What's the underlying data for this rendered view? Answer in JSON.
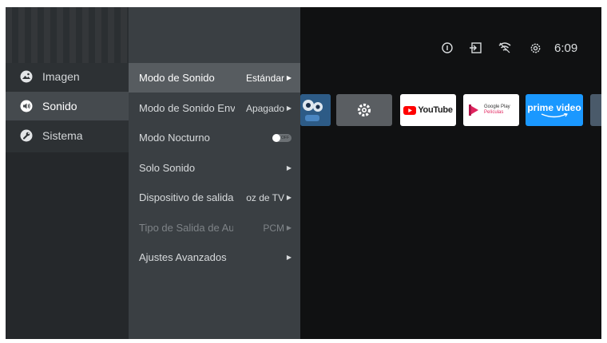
{
  "status_bar": {
    "time": "6:09",
    "icons": [
      "info-icon",
      "input-source-icon",
      "wifi-icon",
      "settings-gear-icon"
    ]
  },
  "categories": [
    {
      "label": "Imagen",
      "icon": "image-icon"
    },
    {
      "label": "Sonido",
      "icon": "speaker-icon",
      "selected": true
    },
    {
      "label": "Sistema",
      "icon": "wrench-icon"
    }
  ],
  "submenu": [
    {
      "label": "Modo de Sonido",
      "value": "Estándar",
      "selected": true
    },
    {
      "label": "Modo de Sonido Envolvente",
      "value": "Apagado"
    },
    {
      "label": "Modo Nocturno",
      "toggle": "OFF"
    },
    {
      "label": "Solo Sonido",
      "value": ""
    },
    {
      "label": "Dispositivo de salida",
      "value": "oz de TV"
    },
    {
      "label": "Tipo de Salida de Audio",
      "value": "PCM",
      "disabled": true
    },
    {
      "label": "Ajustes Avanzados",
      "value": ""
    }
  ],
  "apps": [
    {
      "name": "YouTube",
      "icon": "youtube-icon"
    },
    {
      "name": "Google Play Películas",
      "line1": "Google Play",
      "line2": "Películas",
      "icon": "google-play-movies-icon"
    },
    {
      "name": "prime video",
      "icon": "prime-video-icon"
    }
  ],
  "colors": {
    "youtube_red": "#ff0000",
    "play_movies_red": "#e0245e",
    "prime_blue": "#1a98ff"
  }
}
